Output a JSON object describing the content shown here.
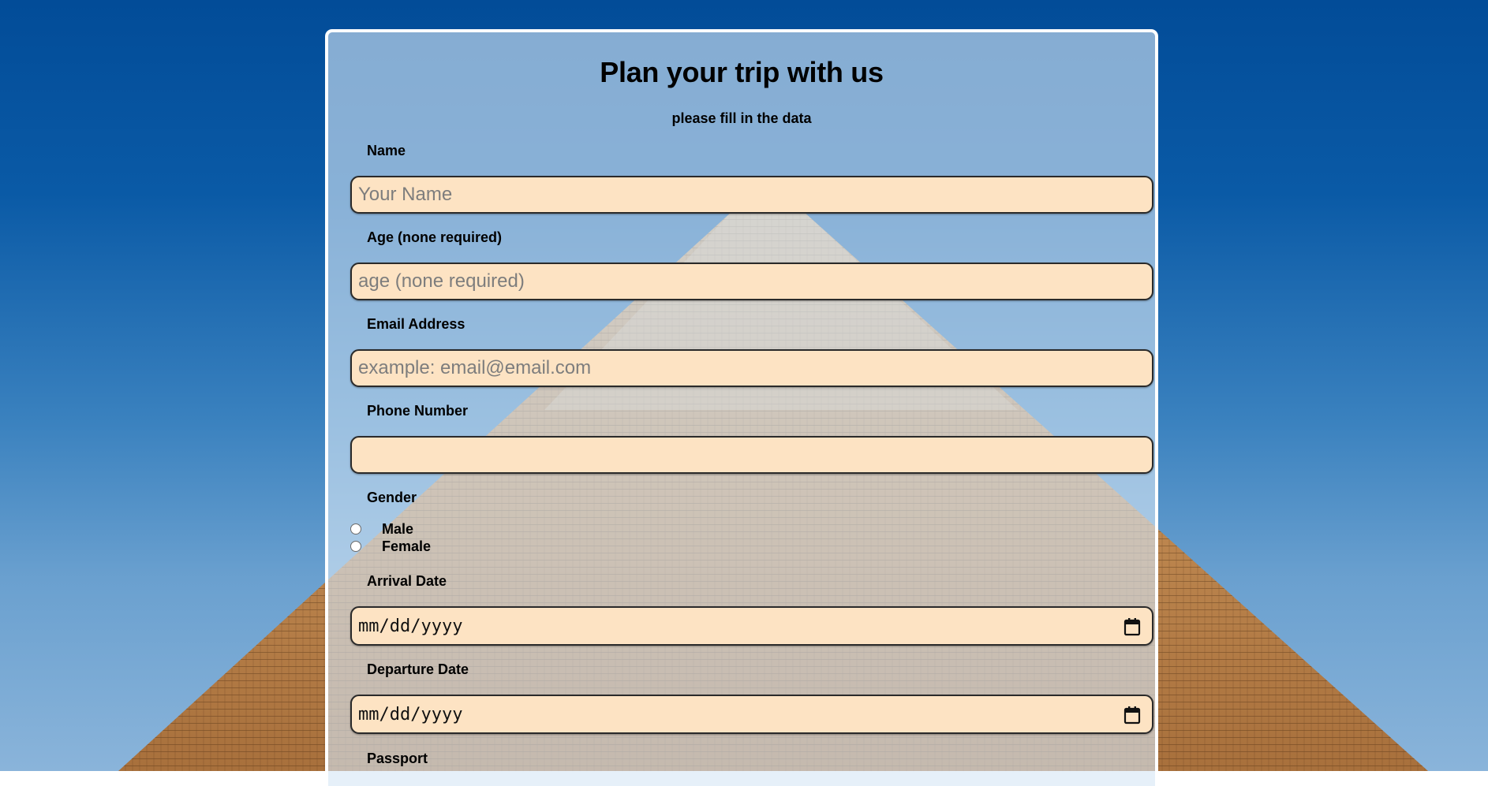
{
  "form": {
    "title": "Plan your trip with us",
    "subtitle": "please fill in the data",
    "name": {
      "label": "Name",
      "placeholder": "Your Name",
      "value": ""
    },
    "age": {
      "label": "Age (none required)",
      "placeholder": "age (none required)",
      "value": ""
    },
    "email": {
      "label": "Email Address",
      "placeholder": "example: email@email.com",
      "value": ""
    },
    "phone": {
      "label": "Phone Number",
      "placeholder": "",
      "value": ""
    },
    "gender": {
      "label": "Gender",
      "options": [
        "Male",
        "Female"
      ],
      "selected": null
    },
    "arrival": {
      "label": "Arrival Date",
      "display": "mm/dd/yyyy"
    },
    "departure": {
      "label": "Departure Date",
      "display": "mm/dd/yyyy"
    },
    "passport": {
      "label": "Passport"
    }
  },
  "colors": {
    "field_background": "#fde3c3",
    "card_border": "#ffffff",
    "sky": "#024c98",
    "pyramid": "#c98a4a"
  },
  "icons": {
    "calendar": "calendar-icon"
  }
}
